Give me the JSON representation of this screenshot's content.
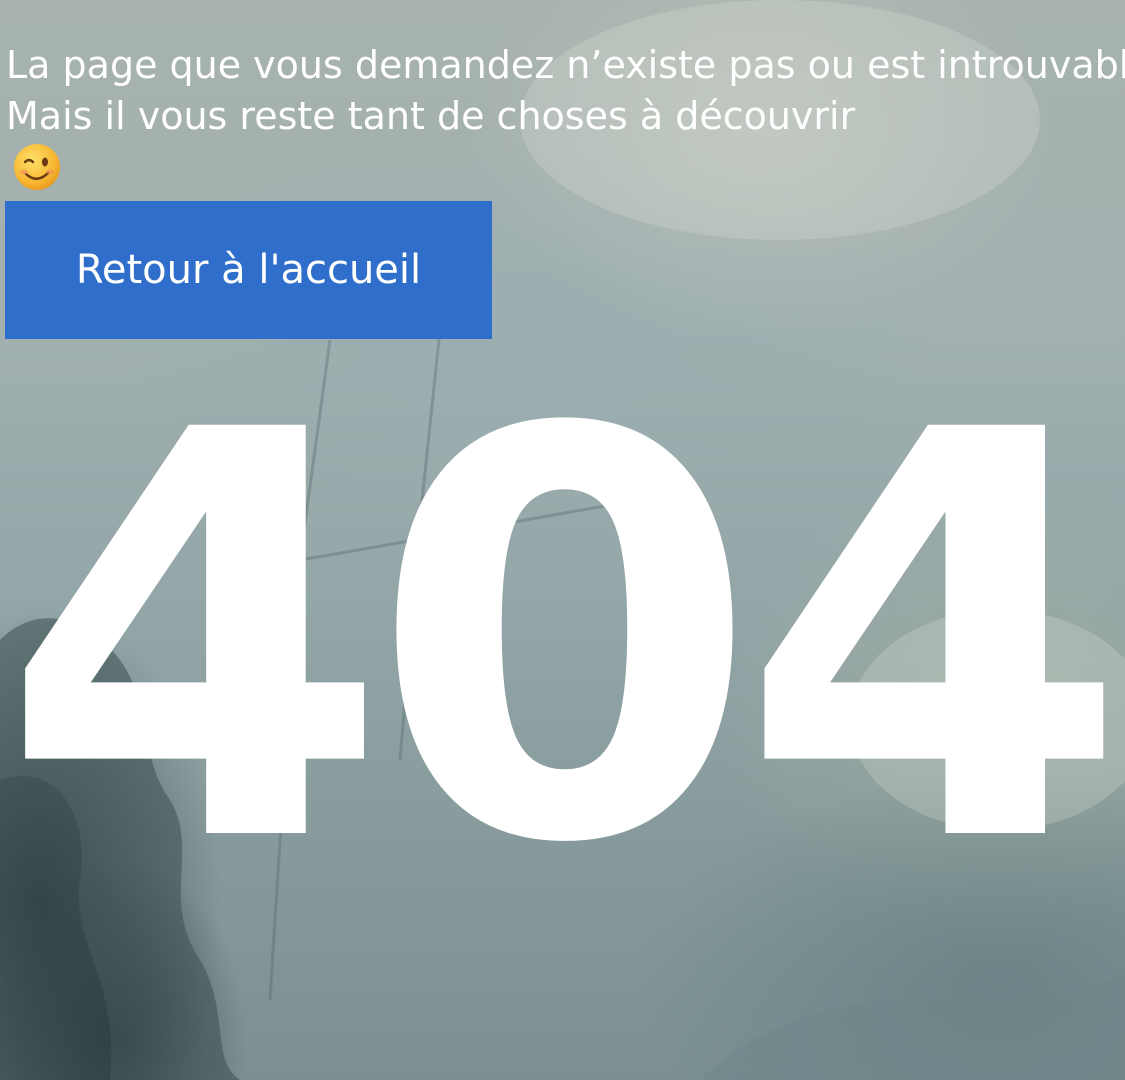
{
  "error": {
    "message_line_1": "La page que vous demandez n’existe pas ou est introuvable.",
    "message_line_2": "Mais il vous reste tant de choses à découvrir",
    "emoji": "winking-face",
    "home_button_label": "Retour à l'accueil",
    "code": "404"
  },
  "colors": {
    "button_background": "#2f6fcb",
    "text": "#ffffff"
  }
}
